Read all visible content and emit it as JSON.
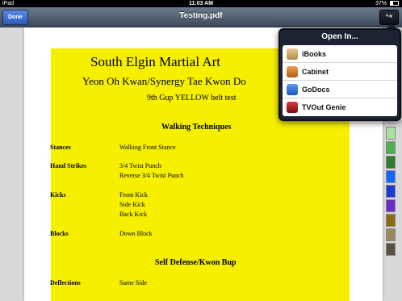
{
  "status": {
    "carrier": "iPad",
    "time": "11:03 AM",
    "battery": "37%"
  },
  "nav": {
    "done_label": "Done",
    "title": "Testing.pdf",
    "share_icon": "share-icon"
  },
  "doc": {
    "title": "South Elgin Martial Art",
    "subtitle": "Yeon Oh Kwan/Synergy Tae Kwon Do",
    "test": "9th Gup YELLOW belt test",
    "section1": "Walking Techniques",
    "rows": [
      {
        "label": "Stances",
        "values": [
          "Walking Front Stance"
        ]
      },
      {
        "label": "Hand Strikes",
        "values": [
          "3/4 Twist Punch",
          "Reverse 3/4 Twist Punch"
        ]
      },
      {
        "label": "Kicks",
        "values": [
          "Front Kick",
          "Side Kick",
          "Back Kick"
        ]
      },
      {
        "label": "Blocks",
        "values": [
          "Down Block"
        ]
      }
    ],
    "section2": "Self Defense/Kwon Bup",
    "rows2": [
      {
        "label": "Deflections",
        "values": [
          "Same Side"
        ]
      }
    ]
  },
  "open_in": {
    "title": "Open In...",
    "items": [
      {
        "label": "iBooks",
        "icon": "ibooks-icon",
        "color": "#c8a060"
      },
      {
        "label": "Cabinet",
        "icon": "cabinet-icon",
        "color": "#d47a2a"
      },
      {
        "label": "GoDocs",
        "icon": "godocs-icon",
        "color": "#2d6fd6"
      },
      {
        "label": "TVOut Genie",
        "icon": "tvout-genie-icon",
        "color": "#b01818"
      }
    ]
  },
  "thumb_colors": [
    "#a8e0a0",
    "#4caf50",
    "#2e7d32",
    "#1565ff",
    "#1a3bd6",
    "#6a2bc8",
    "#8b6b10",
    "#9a8a60",
    "#5a5040"
  ],
  "colors": {
    "highlight": "#f6ef00"
  }
}
